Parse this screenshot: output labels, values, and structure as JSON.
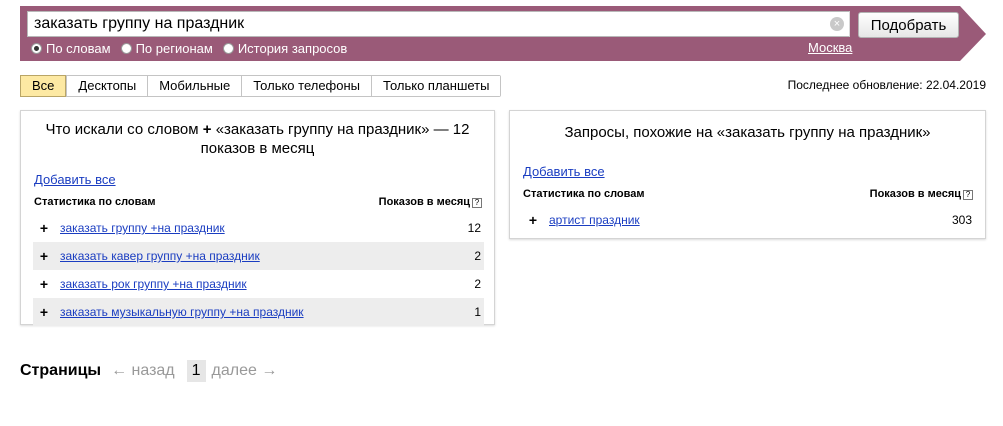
{
  "search": {
    "query": "заказать группу на праздник",
    "submit_label": "Подобрать",
    "clear_glyph": "×",
    "modes": [
      {
        "label": "По словам",
        "checked": true
      },
      {
        "label": "По регионам",
        "checked": false
      },
      {
        "label": "История запросов",
        "checked": false
      }
    ],
    "region": "Москва"
  },
  "tabs": [
    {
      "label": "Все",
      "active": true
    },
    {
      "label": "Десктопы",
      "active": false
    },
    {
      "label": "Мобильные",
      "active": false
    },
    {
      "label": "Только телефоны",
      "active": false
    },
    {
      "label": "Только планшеты",
      "active": false
    }
  ],
  "last_update": "Последнее обновление: 22.04.2019",
  "left_panel": {
    "title_part1": "Что искали со словом",
    "title_plus": "+",
    "title_part2": "«заказать группу на праздник» — 12 показов в месяц",
    "add_all": "Добавить все",
    "col_words": "Статистика по словам",
    "col_count": "Показов в месяц",
    "help_glyph": "?",
    "rows": [
      {
        "plus": "+",
        "phrase": "заказать группу +на праздник",
        "count": "12"
      },
      {
        "plus": "+",
        "phrase": "заказать кавер группу +на праздник",
        "count": "2"
      },
      {
        "plus": "+",
        "phrase": "заказать рок группу +на праздник",
        "count": "2"
      },
      {
        "plus": "+",
        "phrase": "заказать музыкальную группу +на праздник",
        "count": "1"
      }
    ]
  },
  "right_panel": {
    "title": "Запросы, похожие на «заказать группу на праздник»",
    "add_all": "Добавить все",
    "col_words": "Статистика по словам",
    "col_count": "Показов в месяц",
    "help_glyph": "?",
    "rows": [
      {
        "plus": "+",
        "phrase": "артист праздник",
        "count": "303"
      }
    ]
  },
  "pager": {
    "title": "Страницы",
    "prev": "← назад",
    "current": "1",
    "next": "далее →"
  },
  "colors": {
    "header_bg": "#9a5a78",
    "link": "#1a3dc1",
    "active_tab": "#fde9a3"
  }
}
